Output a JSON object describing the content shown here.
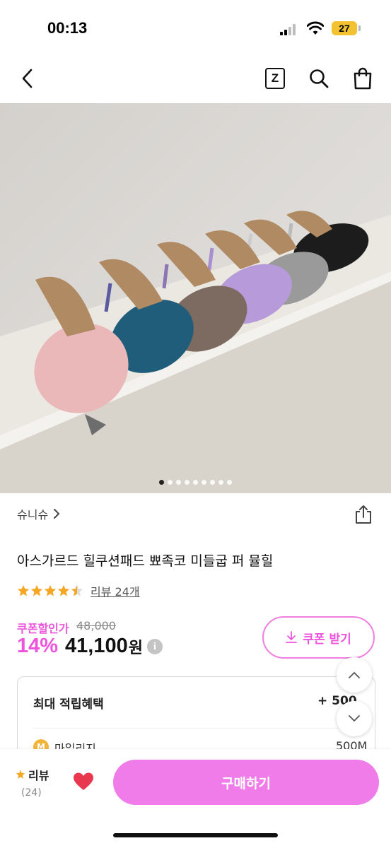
{
  "status_bar": {
    "time": "00:13",
    "battery": "27"
  },
  "nav": {
    "z_label": "Z",
    "icons": [
      "back-icon",
      "z-icon",
      "search-icon",
      "shopping-bag-icon"
    ]
  },
  "product": {
    "image_count": 9,
    "active_image_index": 0,
    "brand": "슈니슈",
    "title": "아스가르드 힐쿠션패드 뾰족코 미들굽 퍼 뮬힐",
    "rating_stars": 4.5,
    "review_link": "리뷰 24개",
    "coupon_label": "쿠폰할인가",
    "original_price": "48,000",
    "discount": "14%",
    "price": "41,100",
    "price_unit": "원",
    "info_icon": "i",
    "coupon_button": "쿠폰 받기"
  },
  "benefits": {
    "title": "최대 적립혜택",
    "value": "+ 500",
    "mileage_label": "마일리지",
    "mileage_value": "500M",
    "mileage_coin": "M"
  },
  "bottom_bar": {
    "review_label": "리뷰",
    "review_count": "(24)",
    "buy_button": "구매하기"
  },
  "colors": {
    "accent_pink": "#ee55dd",
    "buy_button": "#ef7ce8",
    "star": "#f5a623",
    "heart": "#e8384f",
    "battery": "#f2c230"
  }
}
